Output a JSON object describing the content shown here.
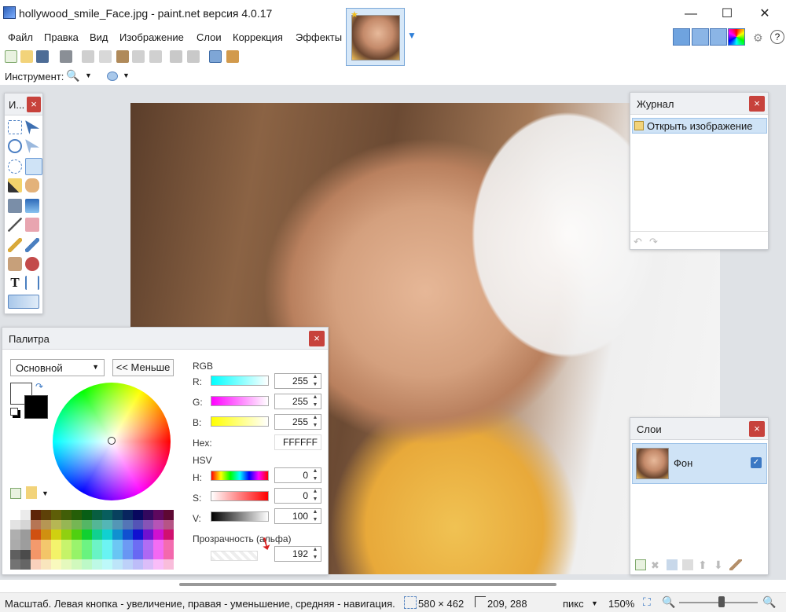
{
  "window": {
    "title": "hollywood_smile_Face.jpg - paint.net версия 4.0.17",
    "minimize": "—",
    "maximize": "☐",
    "close": "✕"
  },
  "menu": [
    "Файл",
    "Правка",
    "Вид",
    "Изображение",
    "Слои",
    "Коррекция",
    "Эффекты"
  ],
  "toolbar": {
    "instrument_label": "Инструмент:"
  },
  "tools_panel": {
    "title": "И...",
    "close": "×"
  },
  "journal": {
    "title": "Журнал",
    "close": "×",
    "items": [
      "Открыть изображение"
    ]
  },
  "layers": {
    "title": "Слои",
    "close": "×",
    "items": [
      {
        "name": "Фон",
        "visible": true
      }
    ]
  },
  "palette": {
    "title": "Палитра",
    "close": "×",
    "mode": "Основной",
    "less_button": "<< Меньше",
    "rgb_label": "RGB",
    "r_label": "R:",
    "g_label": "G:",
    "b_label": "B:",
    "r": "255",
    "g": "255",
    "b": "255",
    "hex_label": "Hex:",
    "hex": "FFFFFF",
    "hsv_label": "HSV",
    "h_label": "H:",
    "s_label": "S:",
    "v_label": "V:",
    "h": "0",
    "s": "0",
    "v": "100",
    "alpha_label": "Прозрачность (альфа)",
    "alpha": "192",
    "primary_color": "#FFFFFF",
    "secondary_color": "#000000"
  },
  "status": {
    "hint": "Масштаб. Левая кнопка - увеличение, правая - уменьшение, средняя - навигация.",
    "size": "580 × 462",
    "cursor": "209, 288",
    "units": "пикс",
    "zoom": "150%"
  },
  "colors": {
    "accent": "#3b78c4",
    "close_red": "#c7423c",
    "selection": "#cfe3f6"
  }
}
